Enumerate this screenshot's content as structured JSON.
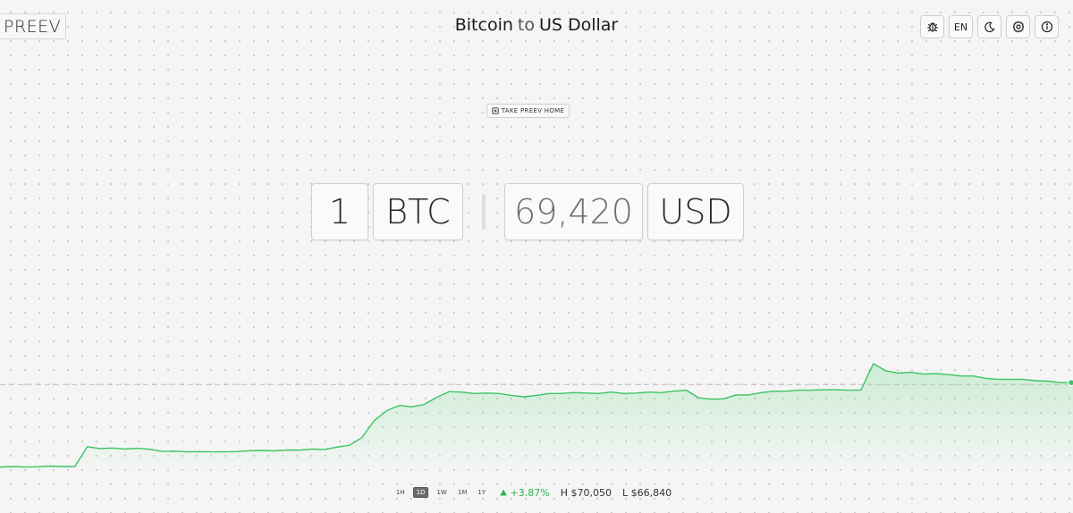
{
  "app": {
    "logo": "PREEV"
  },
  "title": {
    "from": "Bitcoin",
    "connector": "to",
    "target": "US Dollar"
  },
  "toolbar": {
    "language": "EN"
  },
  "home_button": {
    "label": "TAKE PREEV HOME"
  },
  "converter": {
    "amount": "1",
    "from_currency": "BTC",
    "result": "69,420",
    "to_currency": "USD"
  },
  "footer": {
    "ranges": [
      "1H",
      "1D",
      "1W",
      "1M",
      "1Y"
    ],
    "active_range": "1D",
    "change": "+3.87%",
    "high": "H $70,050",
    "low": "L $66,840"
  },
  "colors": {
    "accent_green": "#2fb54f",
    "line_green": "#3cc463"
  },
  "chart_data": {
    "type": "area",
    "values": [
      66840,
      66850,
      66840,
      66845,
      66860,
      66850,
      66850,
      67270,
      67230,
      67240,
      67220,
      67235,
      67215,
      67170,
      67175,
      67160,
      67165,
      67160,
      67160,
      67165,
      67185,
      67190,
      67180,
      67200,
      67195,
      67220,
      67210,
      67260,
      67300,
      67460,
      67820,
      68030,
      68140,
      68110,
      68160,
      68310,
      68430,
      68420,
      68390,
      68400,
      68390,
      68350,
      68320,
      68350,
      68390,
      68390,
      68410,
      68400,
      68390,
      68420,
      68390,
      68400,
      68420,
      68410,
      68440,
      68460,
      68300,
      68270,
      68280,
      68360,
      68360,
      68410,
      68440,
      68440,
      68460,
      68460,
      68470,
      68470,
      68460,
      68460,
      69020,
      68870,
      68820,
      68840,
      68800,
      68810,
      68790,
      68760,
      68760,
      68710,
      68690,
      68690,
      68690,
      68660,
      68650,
      68620,
      68620
    ],
    "reference_value": 68580,
    "ylim": [
      66700,
      69150
    ],
    "grid": false,
    "legend": "none"
  }
}
